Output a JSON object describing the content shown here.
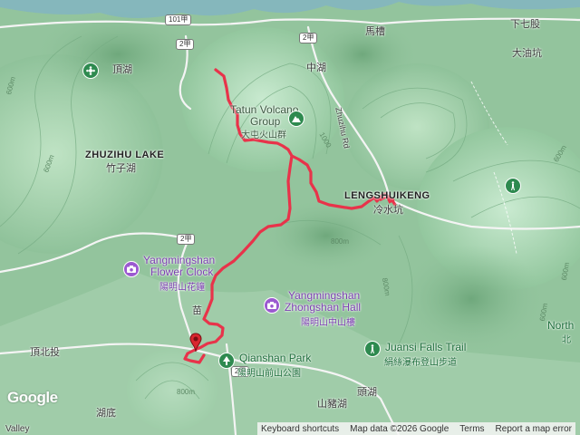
{
  "map": {
    "places": {
      "dinghu": "頂湖",
      "zhuzihu_lake_en": "ZHUZIHU LAKE",
      "zhuzihu_lake_zh": "竹子湖",
      "tatun_en_1": "Tatun Volcano",
      "tatun_en_2": "Group",
      "tatun_zh": "大屯火山群",
      "zhonghu": "中湖",
      "macao": "馬槽",
      "xiaqigu": "下七股",
      "dayoukeng": "大油坑",
      "lengshuikeng_en": "LENGSHUIKENG",
      "lengshuikeng_zh": "冷水坑",
      "zhuzihu_rd": "Zhuzihu Rd",
      "miao": "苗",
      "dingbeitou": "頂北投",
      "hudi": "湖底",
      "toutou": "頭湖",
      "shanzhuhu": "山豬湖",
      "north_edge": "North",
      "north_edge_zh": "北",
      "valley": "Valley"
    },
    "pois": {
      "flower_clock_en_1": "Yangmingshan",
      "flower_clock_en_2": "Flower Clock",
      "flower_clock_zh": "陽明山花鐘",
      "zhongshan_hall_en_1": "Yangmingshan",
      "zhongshan_hall_en_2": "Zhongshan Hall",
      "zhongshan_hall_zh": "陽明山中山樓",
      "qianshan_park_en": "Qianshan Park",
      "qianshan_park_zh": "陽明山前山公園",
      "juansi_en": "Juansi Falls Trail",
      "juansi_zh": "絹絲瀑布登山步道"
    },
    "road_shields": [
      "101甲",
      "2甲",
      "2甲",
      "2甲",
      "2甲"
    ],
    "contours": [
      "600m",
      "600m",
      "800m",
      "1000",
      "800m",
      "600m",
      "600m",
      "600m",
      "800m"
    ],
    "route_color": "#e8334a",
    "marker_color": "#d9262f"
  },
  "attribution": {
    "logo": "Google",
    "keyboard": "Keyboard shortcuts",
    "data": "Map data ©2026 Google",
    "terms": "Terms",
    "report": "Report a map error"
  }
}
